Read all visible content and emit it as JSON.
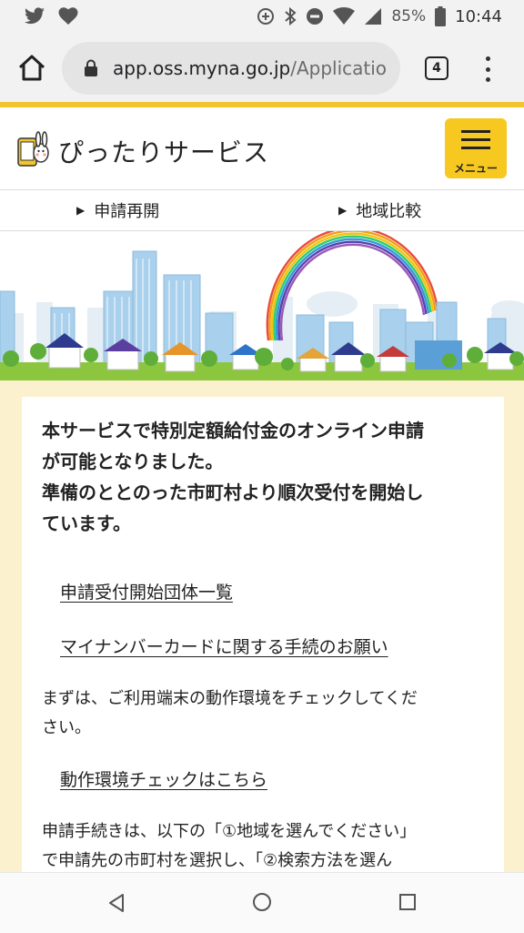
{
  "status_bar": {
    "battery_percent": "85%",
    "time": "10:44",
    "icons": [
      "twitter-icon",
      "heart-icon",
      "data-saver-icon",
      "bluetooth-icon",
      "do-not-disturb-icon",
      "wifi-icon",
      "signal-icon",
      "battery-icon"
    ]
  },
  "browser": {
    "url_domain": "app.oss.myna.go.jp",
    "url_path": "/Applicatio",
    "tab_count": "4"
  },
  "header": {
    "site_name": "ぴったりサービス",
    "menu_label": "メニュー"
  },
  "subnav": {
    "items": [
      {
        "label": "申請再開"
      },
      {
        "label": "地域比較"
      }
    ]
  },
  "main": {
    "lead_lines": [
      "本サービスで特別定額給付金のオンライン申請",
      "が可能となりました。",
      "準備のととのった市町村より順次受付を開始し",
      "ています。"
    ],
    "links": {
      "org_list": "申請受付開始団体一覧",
      "mynumber_request": "マイナンバーカードに関する手続のお願い",
      "env_check": "動作環境チェックはこちら"
    },
    "para_env_lines": [
      "まずは、ご利用端末の動作環境をチェックしてくだ",
      "さい。"
    ],
    "para_procedure_lines": [
      "申請手続きは、以下の「①地域を選んでください」",
      "で申請先の市町村を選択し、「②検索方法を選ん"
    ]
  },
  "colors": {
    "accent_yellow": "#f6c820",
    "content_background": "#fbf1cf"
  }
}
